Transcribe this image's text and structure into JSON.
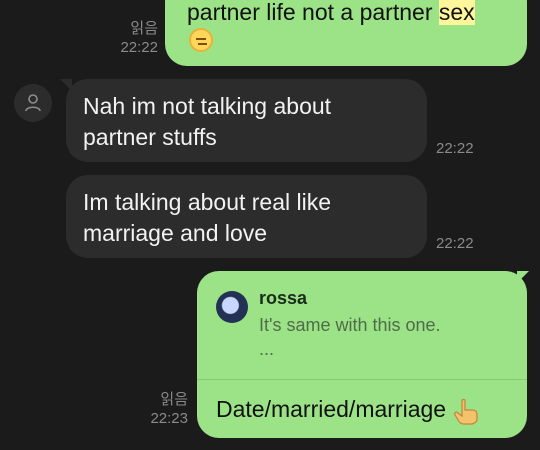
{
  "chat": {
    "top_read": "읽음",
    "top_time": "22:22",
    "top_line": "partner life not a partner",
    "top_highlight": "sex",
    "msg1_line1": "Nah im not talking about",
    "msg1_line2": "partner stuffs",
    "msg1_time": "22:22",
    "msg2_line1": "Im talking about real like",
    "msg2_line2": "marriage and love",
    "msg2_time": "22:22",
    "reply_name": "rossa",
    "reply_text": "It's same with this one.",
    "reply_more": "...",
    "reply_msg": "Date/married/marriage",
    "bottom_read": "읽음",
    "bottom_time": "22:23"
  }
}
